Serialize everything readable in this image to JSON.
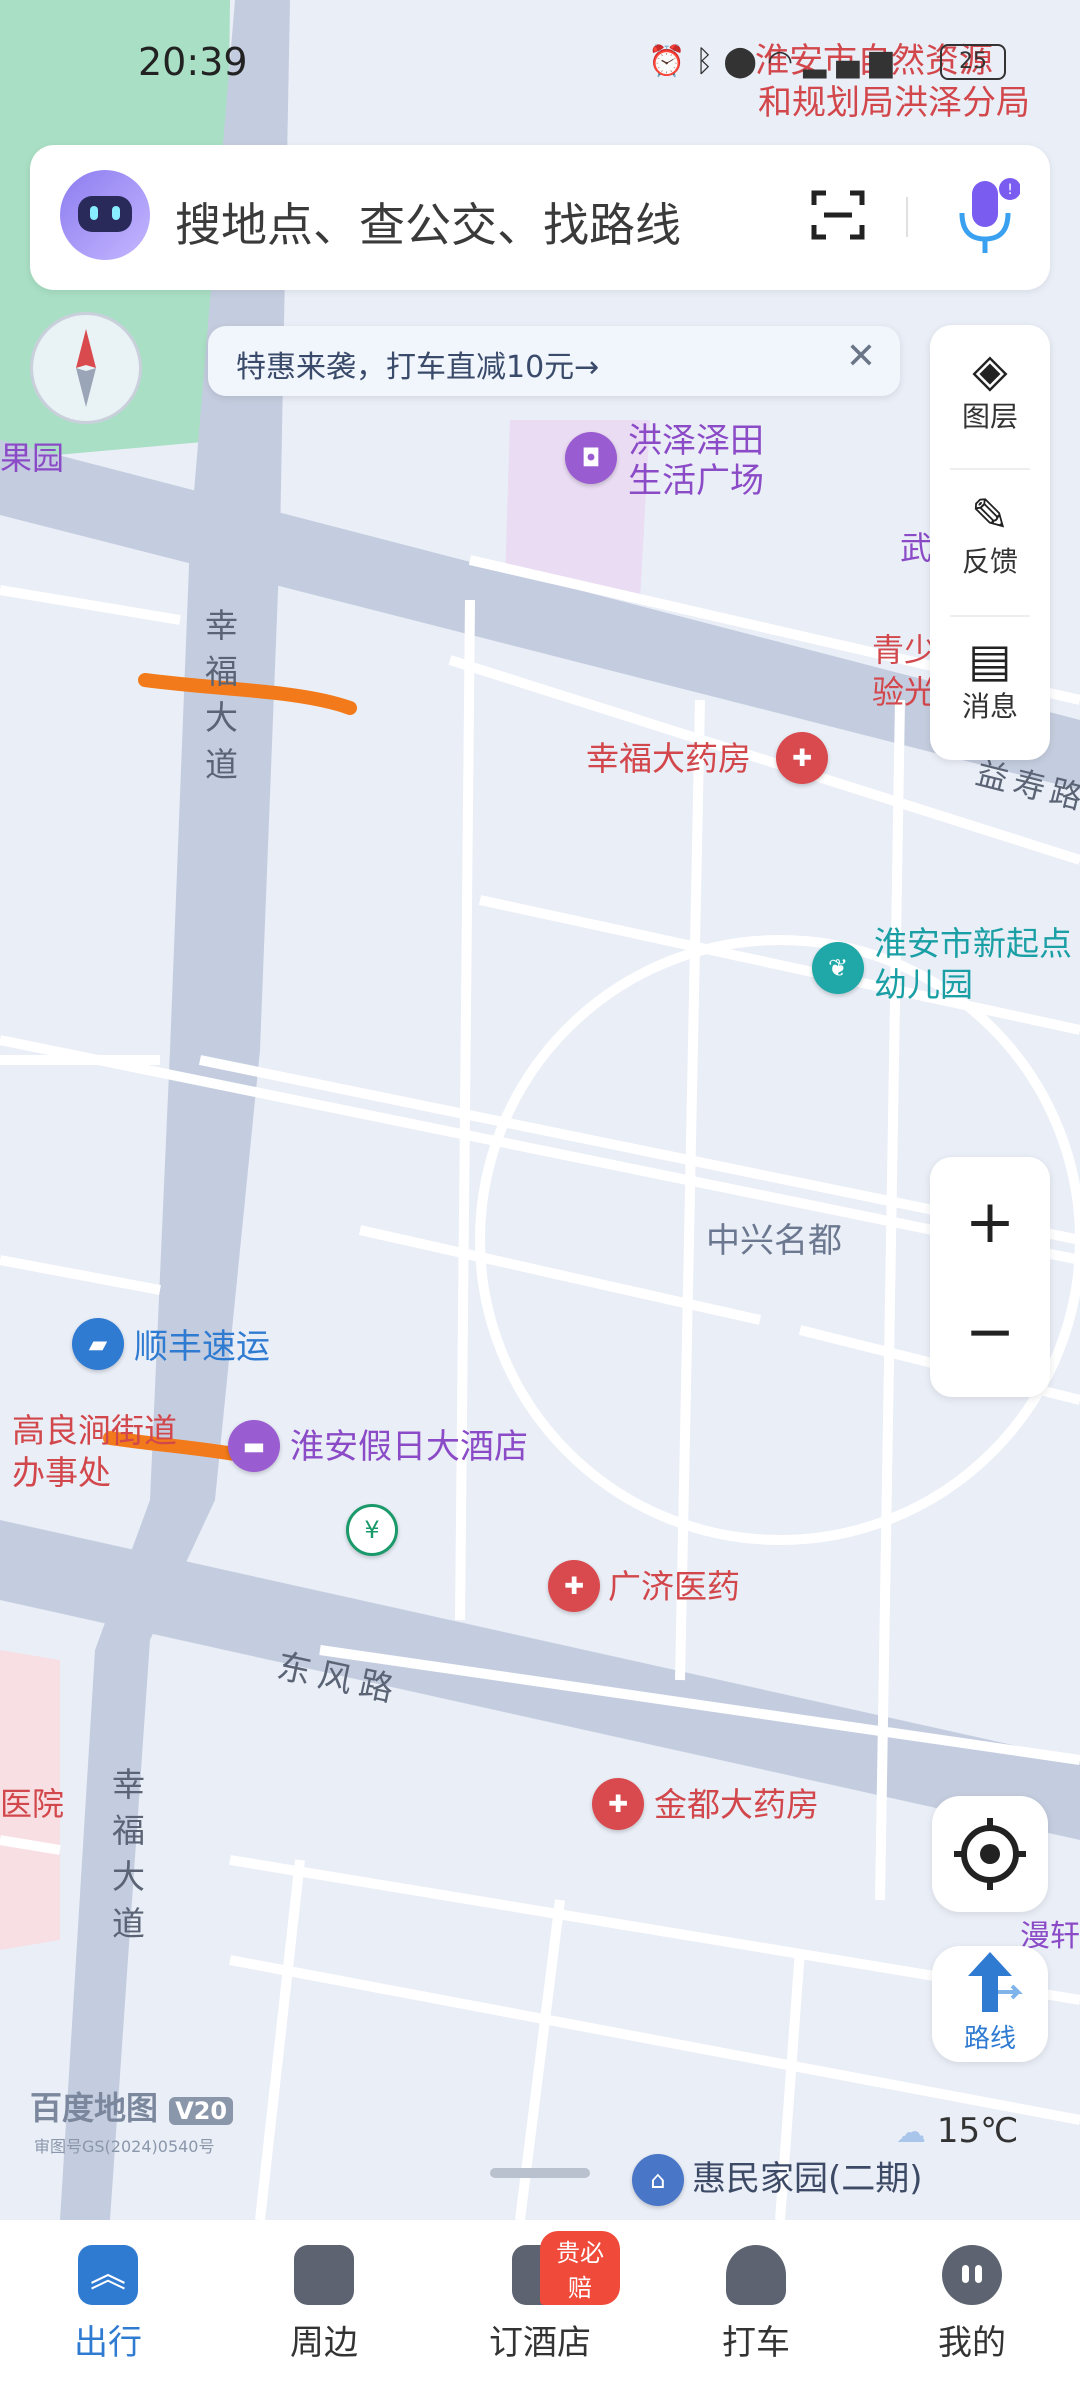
{
  "status_bar": {
    "time": "20:39",
    "battery": "25"
  },
  "search": {
    "placeholder": "搜地点、查公交、找路线"
  },
  "promo": {
    "text": "特惠来袭，打车直减10元→"
  },
  "right_panel": {
    "layers": "图层",
    "feedback": "反馈",
    "messages": "消息"
  },
  "map": {
    "labels": {
      "natural_resources": "淮安市自然资源",
      "natural_resources_2": "和规划局洪泽分局",
      "guoyuan": "果园",
      "hongze_mall_1": "洪泽泽田",
      "hongze_mall_2": "生活广场",
      "wu": "武",
      "youth_1": "青少",
      "youth_2": "验光",
      "xingfu_pharmacy": "幸福大药房",
      "yishou_road": "益寿路",
      "kindergarten_1": "淮安市新起点",
      "kindergarten_2": "幼儿园",
      "road_xingfu": "幸福大道",
      "zhongxing": "中兴名都",
      "sf_express": "顺丰速运",
      "gaoliang_1": "高良涧街道",
      "gaoliang_2": "办事处",
      "holiday_hotel": "淮安假日大酒店",
      "guangji": "广济医药",
      "dongfeng_road": "东风路",
      "jindu_pharmacy": "金都大药房",
      "road_xingfu_2": "幸福大道",
      "hospital": "医院",
      "man": "漫轩",
      "huimin": "惠民家园(二期)"
    },
    "brand": "百度地图",
    "version": "V20",
    "license": "审图号GS(2024)0540号",
    "weather": "15℃"
  },
  "controls": {
    "zoom_in": "+",
    "zoom_out": "−",
    "route": "路线"
  },
  "tabs": [
    {
      "label": "出行",
      "active": true
    },
    {
      "label": "周边",
      "active": false
    },
    {
      "label": "订酒店",
      "active": false,
      "badge": "贵必赔"
    },
    {
      "label": "打车",
      "active": false
    },
    {
      "label": "我的",
      "active": false
    }
  ],
  "colors": {
    "accent": "#2f7bd2",
    "red_poi": "#d2474b",
    "purple_poi": "#8b4bc7",
    "teal_poi": "#1a9fa5",
    "markup": "#f27a1a"
  }
}
